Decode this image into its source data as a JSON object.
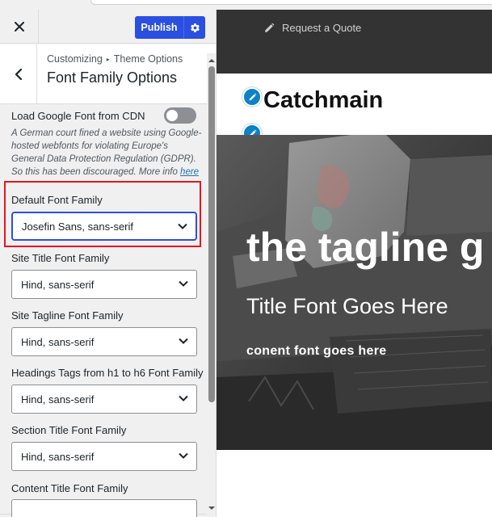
{
  "customizer": {
    "header": {
      "close_icon": "close-icon",
      "publish_label": "Publish",
      "settings_icon": "gear-icon"
    },
    "section": {
      "back_icon": "chevron-left-icon",
      "breadcrumb_root": "Customizing",
      "breadcrumb_separator": "▸",
      "breadcrumb_parent": "Theme Options",
      "title": "Font Family Options"
    },
    "google_font": {
      "label": "Load Google Font from CDN",
      "enabled": false,
      "description": "A German court fined a website using Google-hosted webfonts for violating Europe's General Data Protection Regulation (GDPR). So this has been discouraged. More info ",
      "link_text": "here"
    },
    "fields": [
      {
        "label": "Default Font Family",
        "value": "Josefin Sans, sans-serif"
      },
      {
        "label": "Site Title Font Family",
        "value": "Hind, sans-serif"
      },
      {
        "label": "Site Tagline Font Family",
        "value": "Hind, sans-serif"
      },
      {
        "label": "Headings Tags from h1 to h6 Font Family",
        "value": "Hind, sans-serif"
      },
      {
        "label": "Section Title Font Family",
        "value": "Hind, sans-serif"
      },
      {
        "label": "Content Title Font Family",
        "value": ""
      }
    ]
  },
  "preview": {
    "topbar_link_icon": "pencil-icon",
    "topbar_link": "Request a Quote",
    "site_title": "Catchmain",
    "hero": {
      "tagline": "the tagline g",
      "title": "Title Font Goes Here",
      "content": "conent font goes here"
    }
  },
  "colors": {
    "accent": "#2b4fe0",
    "highlight": "#e8141c",
    "topbar": "#333333",
    "edit_badge": "#0b81c6"
  }
}
